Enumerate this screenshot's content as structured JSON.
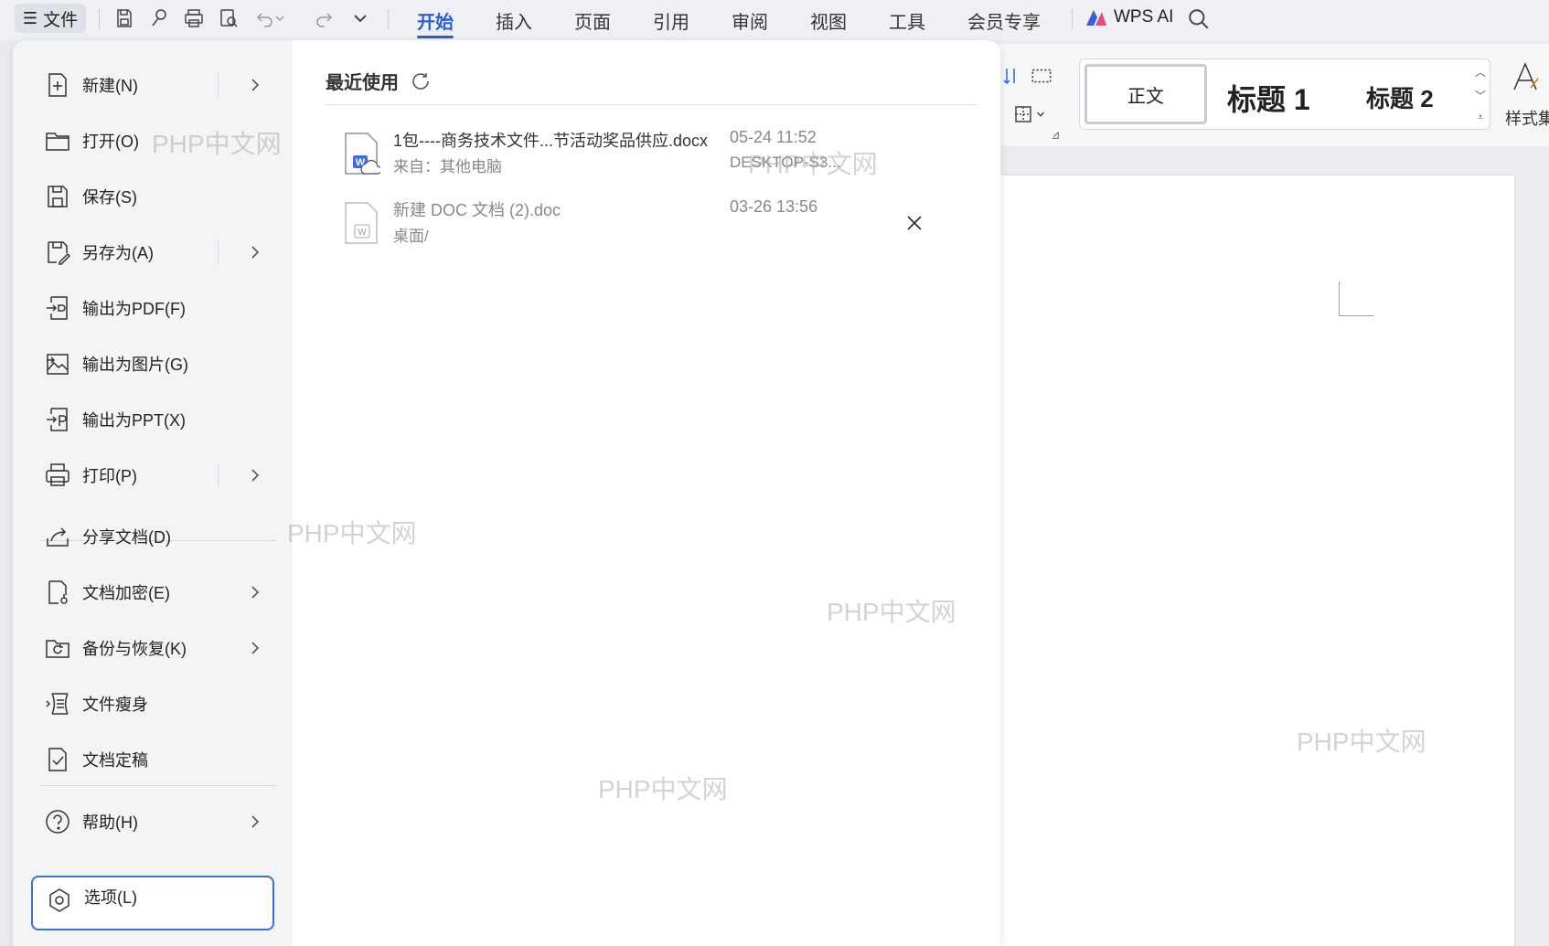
{
  "toolbar": {
    "file_label": "文件",
    "tabs": [
      {
        "label": "开始"
      },
      {
        "label": "插入"
      },
      {
        "label": "页面"
      },
      {
        "label": "引用"
      },
      {
        "label": "审阅"
      },
      {
        "label": "视图"
      },
      {
        "label": "工具"
      },
      {
        "label": "会员专享"
      }
    ],
    "ai_label": "WPS AI",
    "accent": "#2b5fd0"
  },
  "ribbon": {
    "styles": [
      {
        "label": "正文"
      },
      {
        "label": "标题 1"
      },
      {
        "label": "标题 2"
      }
    ],
    "style_set_label": "样式集"
  },
  "file_menu": {
    "items": [
      {
        "label": "新建(N)",
        "icon": "new-doc-icon"
      },
      {
        "label": "打开(O)",
        "icon": "folder-open-icon"
      },
      {
        "label": "保存(S)",
        "icon": "save-icon"
      },
      {
        "label": "另存为(A)",
        "icon": "save-as-icon"
      },
      {
        "label": "输出为PDF(F)",
        "icon": "export-pdf-icon"
      },
      {
        "label": "输出为图片(G)",
        "icon": "export-image-icon"
      },
      {
        "label": "输出为PPT(X)",
        "icon": "export-ppt-icon"
      },
      {
        "label": "打印(P)",
        "icon": "printer-icon"
      },
      {
        "label": "分享文档(D)",
        "icon": "share-icon"
      },
      {
        "label": "文档加密(E)",
        "icon": "encrypt-icon"
      },
      {
        "label": "备份与恢复(K)",
        "icon": "backup-icon"
      },
      {
        "label": "文件瘦身",
        "icon": "slim-icon"
      },
      {
        "label": "文档定稿",
        "icon": "finalize-icon"
      },
      {
        "label": "帮助(H)",
        "icon": "help-icon"
      },
      {
        "label": "选项(L)",
        "icon": "options-icon"
      }
    ]
  },
  "recent": {
    "title": "最近使用",
    "files": [
      {
        "name": "1包----商务技术文件...节活动奖品供应.docx",
        "source": "来自：其他电脑",
        "date": "05-24 11:52",
        "device": "DESKTOP-S3..."
      },
      {
        "name": "新建 DOC 文档 (2).doc",
        "source": "桌面/",
        "date": "03-26 13:56",
        "device": ""
      }
    ]
  },
  "watermark": "PHP中文网"
}
